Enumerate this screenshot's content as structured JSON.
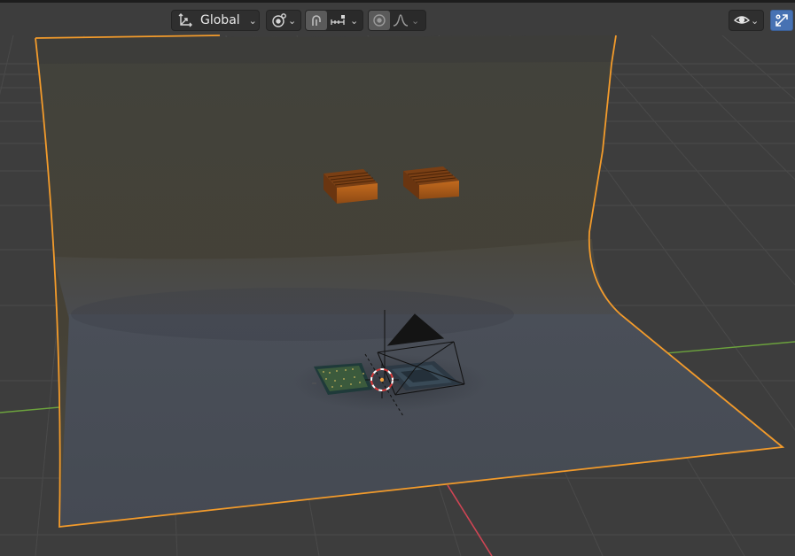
{
  "header": {
    "transform_orientation": {
      "label": "Global",
      "icon": "orientation-gizmo-icon"
    },
    "pivot_point": {
      "icon": "pivot-point-icon"
    },
    "snapping": {
      "icon": "magnet-icon",
      "enabled": true
    },
    "snap_target": {
      "icon": "snap-increment-icon"
    },
    "proportional_editing": {
      "icon": "proportional-edit-icon",
      "enabled": true
    },
    "proportional_falloff": {
      "icon": "falloff-curve-icon"
    },
    "visibility": {
      "icon": "eye-icon"
    },
    "gizmo_toggle": {
      "icon": "gizmo-arrows-icon",
      "enabled": true,
      "accent": "#4772b3"
    }
  },
  "scene": {
    "selection_outline_color": "#f39b2b",
    "grid_color": "#4a4a4a",
    "x_axis_color": "#d04554",
    "y_axis_color": "#6ca33d",
    "objects": [
      "backdrop",
      "heatsink-left",
      "heatsink-right",
      "cpu-chip",
      "board",
      "camera",
      "3d-cursor"
    ]
  }
}
